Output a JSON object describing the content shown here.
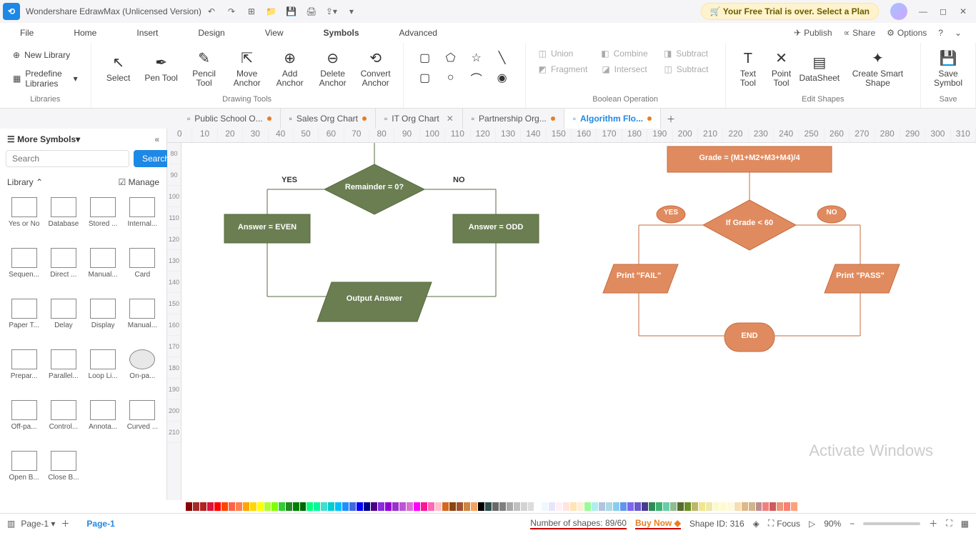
{
  "app": {
    "title": "Wondershare EdrawMax (Unlicensed Version)",
    "trial_banner": "Your Free Trial is over. Select a Plan"
  },
  "menu": {
    "file": "File",
    "home": "Home",
    "insert": "Insert",
    "design": "Design",
    "view": "View",
    "symbols": "Symbols",
    "advanced": "Advanced",
    "publish": "Publish",
    "share": "Share",
    "options": "Options"
  },
  "ribbon": {
    "new_library": "New Library",
    "predefine_libraries": "Predefine Libraries",
    "libraries_label": "Libraries",
    "select": "Select",
    "pen": "Pen Tool",
    "pencil": "Pencil Tool",
    "move_anchor": "Move Anchor",
    "add_anchor": "Add Anchor",
    "delete_anchor": "Delete Anchor",
    "convert_anchor": "Convert Anchor",
    "drawing_label": "Drawing Tools",
    "union": "Union",
    "combine": "Combine",
    "subtract": "Subtract",
    "fragment": "Fragment",
    "intersect": "Intersect",
    "subtract2": "Subtract",
    "boolean_label": "Boolean Operation",
    "text_tool": "Text Tool",
    "point_tool": "Point Tool",
    "datasheet": "DataSheet",
    "smart_shape": "Create Smart Shape",
    "save_symbol": "Save Symbol",
    "edit_label": "Edit Shapes",
    "save_label": "Save"
  },
  "tabs": [
    {
      "label": "Public School O...",
      "modified": true
    },
    {
      "label": "Sales Org Chart",
      "modified": true
    },
    {
      "label": "IT Org Chart",
      "modified": false,
      "close": true
    },
    {
      "label": "Partnership Org...",
      "modified": true
    },
    {
      "label": "Algorithm Flo...",
      "modified": true,
      "active": true
    }
  ],
  "left": {
    "more_symbols": "More Symbols",
    "search_placeholder": "Search",
    "search_btn": "Search",
    "library": "Library",
    "manage": "Manage",
    "items": [
      "Yes or No",
      "Database",
      "Stored ...",
      "Internal...",
      "Sequen...",
      "Direct ...",
      "Manual...",
      "Card",
      "Paper T...",
      "Delay",
      "Display",
      "Manual...",
      "Prepar...",
      "Parallel...",
      "Loop Li...",
      "On-pa...",
      "Off-pa...",
      "Control...",
      "Annota...",
      "Curved ...",
      "Open B...",
      "Close B..."
    ]
  },
  "ruler_h": [
    0,
    10,
    20,
    30,
    40,
    50,
    60,
    70,
    80,
    90,
    100,
    110,
    120,
    130,
    140,
    150,
    160,
    170,
    180,
    190,
    200,
    210,
    220,
    230,
    240,
    250,
    260,
    270,
    280,
    290,
    300,
    310
  ],
  "ruler_v": [
    80,
    90,
    100,
    110,
    120,
    130,
    140,
    150,
    160,
    170,
    180,
    190,
    200,
    210
  ],
  "flowchart": {
    "left": {
      "decision": "Remainder = 0?",
      "yes": "YES",
      "no": "NO",
      "even": "Answer = EVEN",
      "odd": "Answer = ODD",
      "output": "Output Answer"
    },
    "right": {
      "grade": "Grade = (M1+M2+M3+M4)/4",
      "if": "If Grade < 60",
      "yes": "YES",
      "no": "NO",
      "fail": "Print \"FAIL\"",
      "pass": "Print \"PASS\"",
      "end": "END"
    }
  },
  "colors": [
    "#8b0000",
    "#a52a2a",
    "#b22222",
    "#dc143c",
    "#ff0000",
    "#ff4500",
    "#ff6347",
    "#ff7f50",
    "#ffa500",
    "#ffd700",
    "#ffff00",
    "#adff2f",
    "#7fff00",
    "#32cd32",
    "#228b22",
    "#008000",
    "#006400",
    "#00ff7f",
    "#00fa9a",
    "#40e0d0",
    "#00ced1",
    "#00bfff",
    "#1e90ff",
    "#4169e1",
    "#0000ff",
    "#00008b",
    "#4b0082",
    "#8a2be2",
    "#9400d3",
    "#9932cc",
    "#ba55d3",
    "#da70d6",
    "#ff00ff",
    "#ff1493",
    "#ff69b4",
    "#ffc0cb",
    "#d2691e",
    "#8b4513",
    "#a0522d",
    "#cd853f",
    "#f4a460",
    "#000000",
    "#2f4f4f",
    "#696969",
    "#808080",
    "#a9a9a9",
    "#c0c0c0",
    "#d3d3d3",
    "#dcdcdc",
    "#ffffff",
    "#f0f8ff",
    "#e6e6fa",
    "#fff0f5",
    "#ffe4e1",
    "#ffe4b5",
    "#ffefd5",
    "#98fb98",
    "#afeeee",
    "#b0c4de",
    "#add8e6",
    "#87ceeb",
    "#6495ed",
    "#7b68ee",
    "#6a5acd",
    "#483d8b",
    "#2e8b57",
    "#3cb371",
    "#66cdaa",
    "#8fbc8f",
    "#556b2f",
    "#6b8e23",
    "#bdb76b",
    "#f0e68c",
    "#eee8aa",
    "#fafad2",
    "#fffacd",
    "#fff8dc",
    "#f5deb3",
    "#deb887",
    "#d2b48c",
    "#bc8f8f",
    "#f08080",
    "#cd5c5c",
    "#e9967a",
    "#fa8072",
    "#ffa07a"
  ],
  "status": {
    "page": "Page-1",
    "page_tab": "Page-1",
    "shapes": "Number of shapes: 89/60",
    "buy": "Buy Now",
    "shape_id": "Shape ID: 316",
    "focus": "Focus",
    "zoom": "90%"
  },
  "watermark": "Activate Windows"
}
